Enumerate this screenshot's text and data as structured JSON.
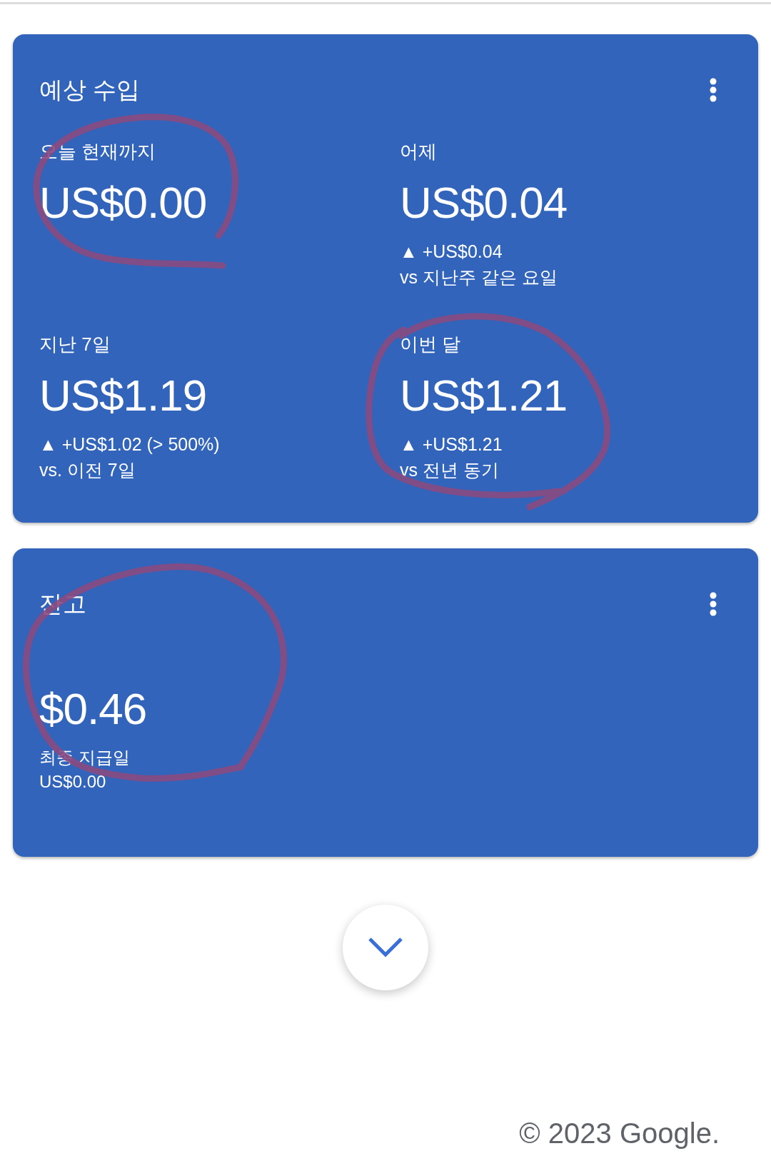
{
  "earnings_card": {
    "title": "예상 수입",
    "metrics": [
      {
        "label": "오늘 현재까지",
        "amount": "US$0.00"
      },
      {
        "label": "어제",
        "amount": "US$0.04",
        "change": "▲ +US$0.04",
        "comparison": "vs 지난주 같은 요일"
      },
      {
        "label": "지난 7일",
        "amount": "US$1.19",
        "change": "▲ +US$1.02 (> 500%)",
        "comparison": "vs. 이전 7일"
      },
      {
        "label": "이번 달",
        "amount": "US$1.21",
        "change": "▲ +US$1.21",
        "comparison": "vs 전년 동기"
      }
    ]
  },
  "balance_card": {
    "title": "잔고",
    "amount": "$0.46",
    "last_payment_label": "최종 지급일",
    "last_payment_amount": "US$0.00"
  },
  "footer": "© 2023 Google."
}
